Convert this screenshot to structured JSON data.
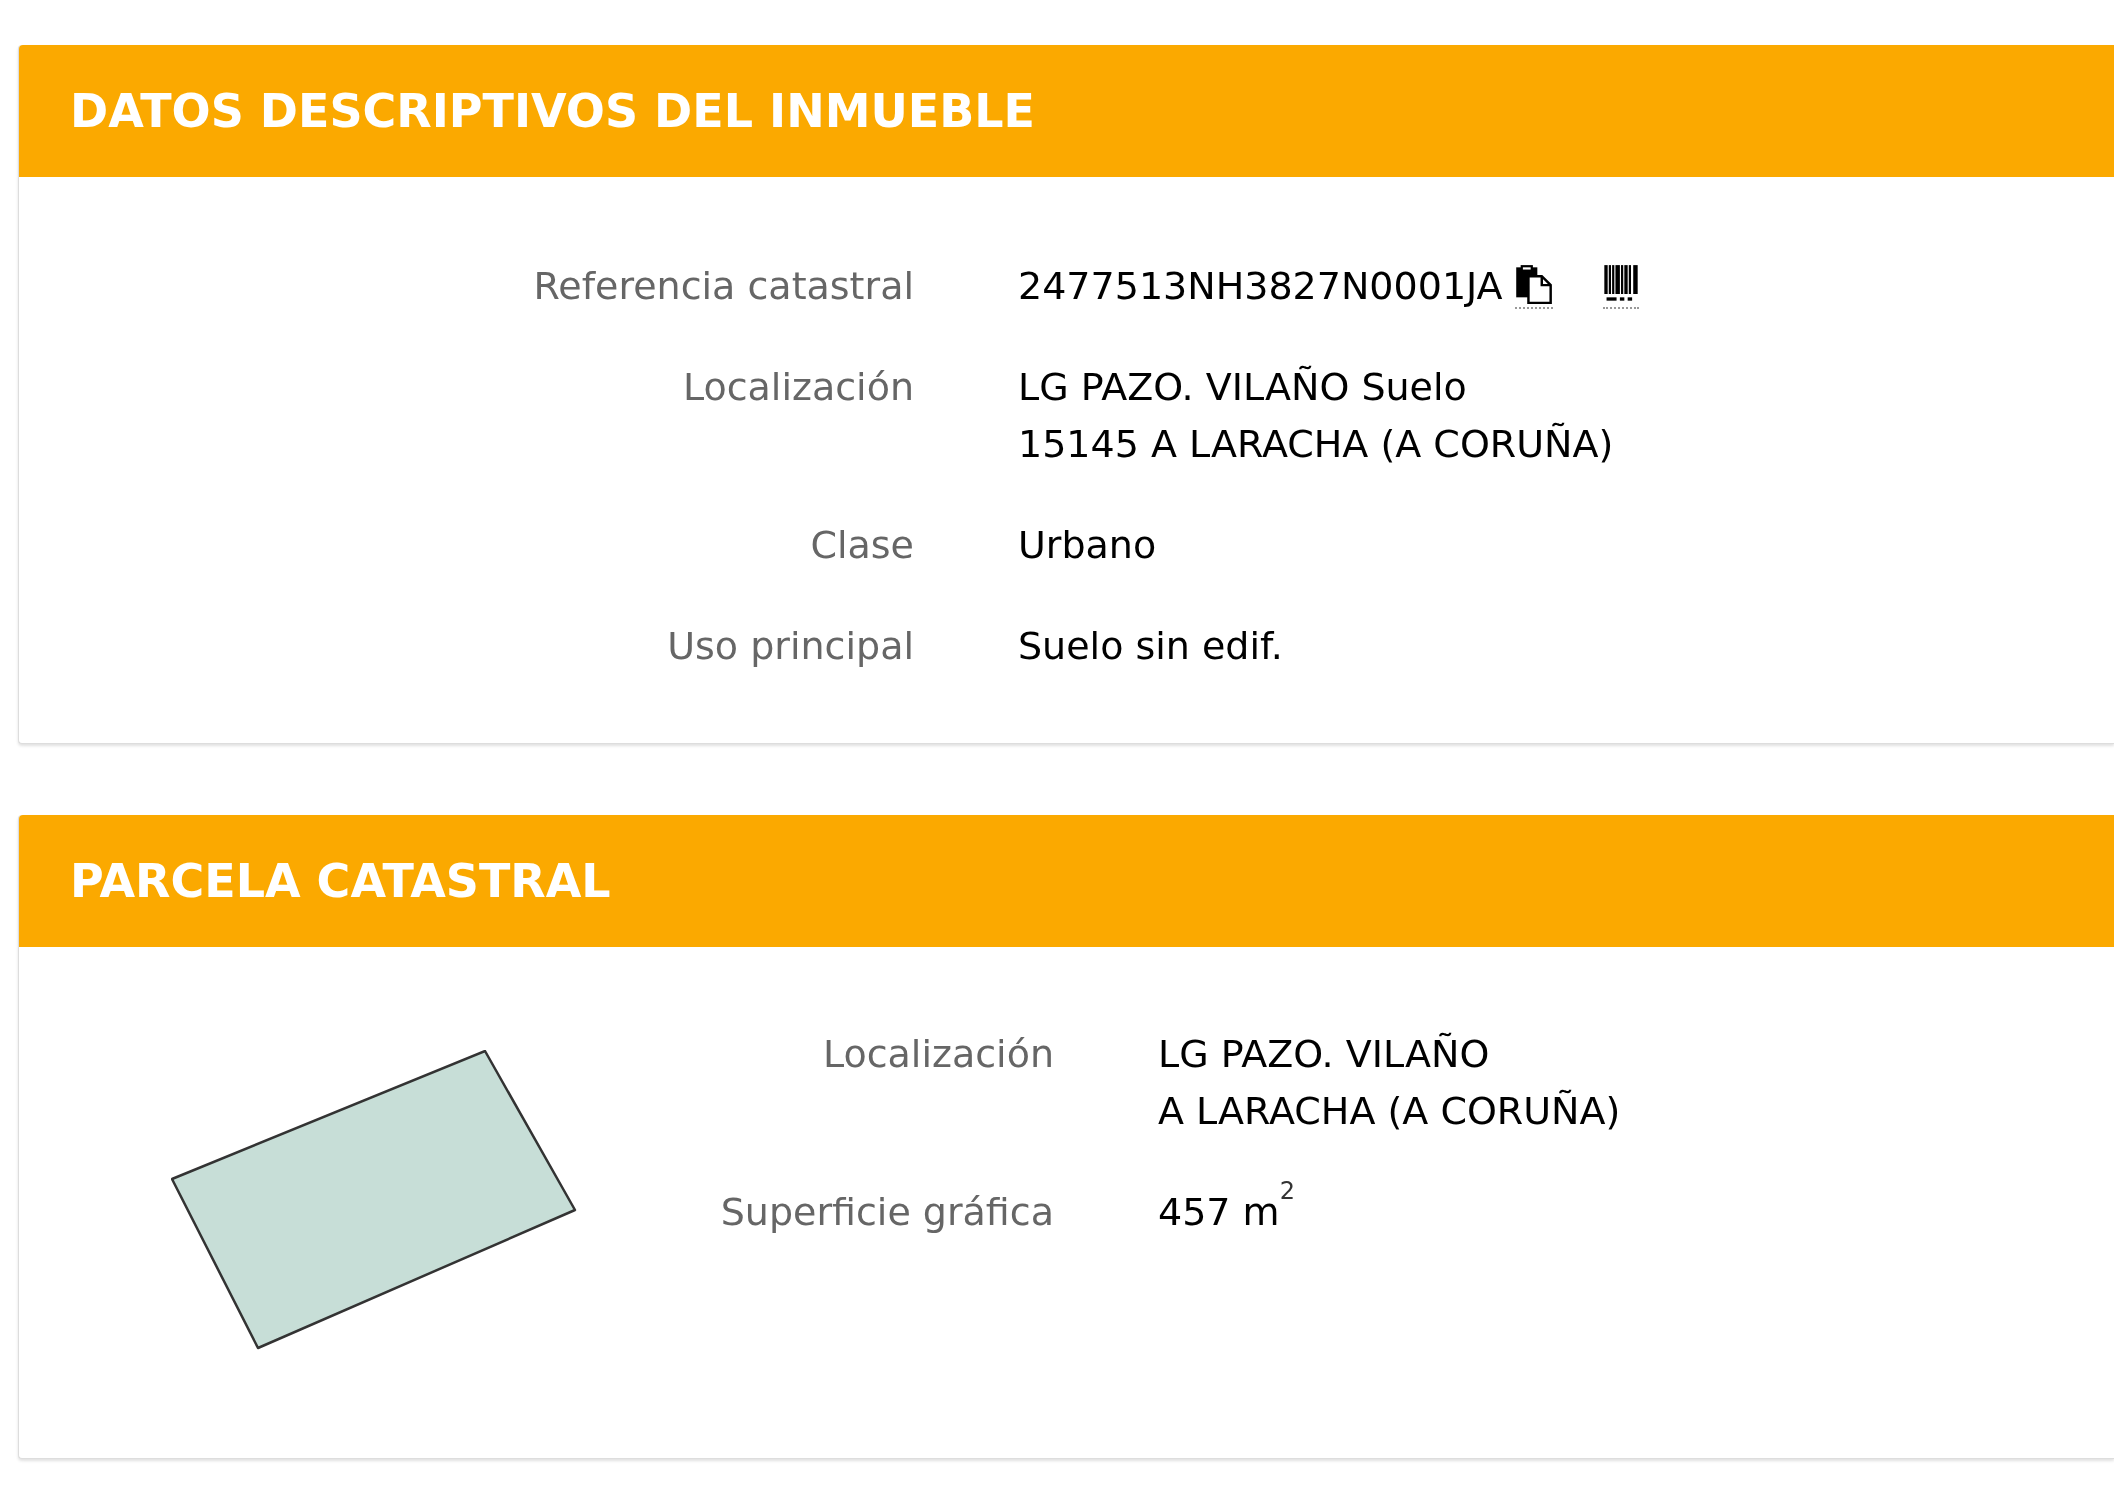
{
  "sections": [
    {
      "kind": "details",
      "title": "DATOS DESCRIPTIVOS DEL INMUEBLE",
      "fields": [
        {
          "kind": "reference",
          "label": "Referencia catastral",
          "lines": [
            "2477513NH3827N0001JA"
          ]
        },
        {
          "kind": "text",
          "label": "Localización",
          "lines": [
            "LG PAZO. VILAÑO Suelo",
            "15145 A LARACHA (A CORUÑA)"
          ]
        },
        {
          "kind": "text",
          "label": "Clase",
          "lines": [
            "Urbano"
          ]
        },
        {
          "kind": "text",
          "label": "Uso principal",
          "lines": [
            "Suelo sin edif."
          ]
        }
      ]
    },
    {
      "kind": "parcel",
      "title": "PARCELA CATASTRAL",
      "fields": [
        {
          "kind": "text",
          "label": "Localización",
          "lines": [
            "LG PAZO. VILAÑO",
            "A LARACHA (A CORUÑA)"
          ]
        },
        {
          "kind": "text",
          "label": "Superficie gráfica",
          "lines": [
            "457 m$^{2}$"
          ]
        }
      ]
    }
  ]
}
